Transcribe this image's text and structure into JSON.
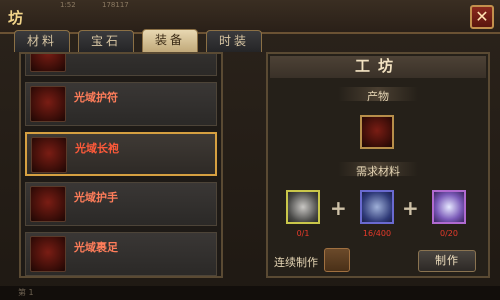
{
  "header": {
    "title": "坊",
    "faint_left": "1:52",
    "faint_right": "178117",
    "close_symbol": "✕"
  },
  "tabs": [
    {
      "label": "材料",
      "active": false
    },
    {
      "label": "宝石",
      "active": false
    },
    {
      "label": "装备",
      "active": true
    },
    {
      "label": "时装",
      "active": false
    }
  ],
  "items": [
    {
      "name": "",
      "selected": false
    },
    {
      "name": "光域护符",
      "selected": false
    },
    {
      "name": "光域长袍",
      "selected": true
    },
    {
      "name": "光域护手",
      "selected": false
    },
    {
      "name": "光域裹足",
      "selected": false
    }
  ],
  "workshop": {
    "title": "工坊",
    "product_label": "产物",
    "materials_label": "需求材料",
    "materials": [
      {
        "icon": "armor-material-icon",
        "count": "0/1"
      },
      {
        "icon": "ore-material-icon",
        "count": "16/400"
      },
      {
        "icon": "crystal-material-icon",
        "count": "0/20"
      }
    ],
    "continuous_label": "连续制作",
    "make_button": "制作"
  },
  "bottom": {
    "text": "第 1"
  },
  "colors": {
    "accent_gold": "#d6a041",
    "item_name_red": "#ff7d5a",
    "count_red": "#e63a2a"
  }
}
